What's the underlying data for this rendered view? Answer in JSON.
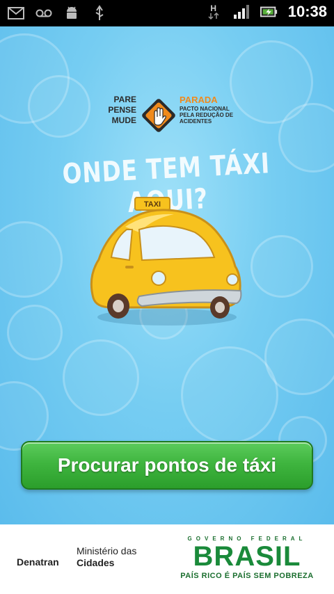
{
  "status_bar": {
    "left_icons": [
      "gmail-icon",
      "voicemail-icon",
      "android-debug-icon",
      "usb-icon"
    ],
    "network_type": "H",
    "right_icons": [
      "hspa-icon",
      "signal-icon",
      "battery-charging-icon"
    ],
    "time": "10:38"
  },
  "logo": {
    "pare_lines": [
      "PARE",
      "PENSE",
      "MUDE"
    ],
    "title": "PARADA",
    "subtitle": "PACTO NACIONAL PELA REDUÇÃO DE ACIDENTES"
  },
  "headline": "ONDE TEM TÁXI AQUI?",
  "taxi": {
    "sign_text": "TAXI"
  },
  "main_button": {
    "label": "Procurar pontos de táxi"
  },
  "footer": {
    "denatran": "Denatran",
    "ministerio_line1": "Ministério das",
    "ministerio_line2": "Cidades",
    "governo": "GOVERNO FEDERAL",
    "brasil": "BRASIL",
    "slogan": "PAÍS RICO É PAÍS SEM POBREZA"
  },
  "colors": {
    "background": "#76cdf2",
    "button": "#3fb53f",
    "parada_orange": "#f08a1c",
    "taxi_yellow": "#f7c21e"
  }
}
